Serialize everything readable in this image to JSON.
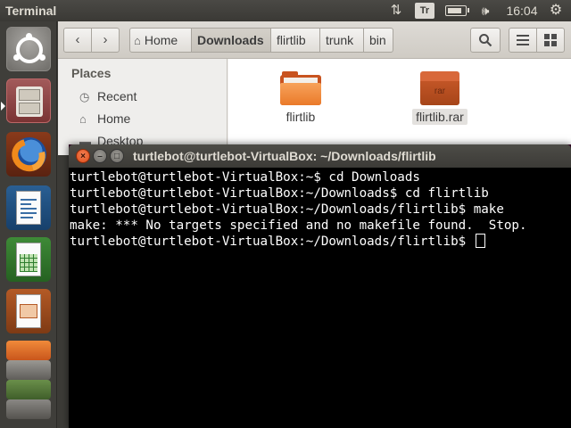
{
  "top_panel": {
    "title": "Terminal",
    "keyboard_layout": "Tr",
    "clock": "16:04",
    "icons": [
      "network-transfer-icon",
      "keyboard-icon",
      "battery-icon",
      "volume-icon",
      "settings-gear-icon"
    ]
  },
  "launcher": {
    "items": [
      "dash-home",
      "files",
      "firefox",
      "libreoffice-writer",
      "libreoffice-calc",
      "libreoffice-impress",
      "software-center",
      "system-settings",
      "workspaces"
    ]
  },
  "files": {
    "nav": {
      "back": "‹",
      "forward": "›"
    },
    "breadcrumbs": [
      "Home",
      "Downloads",
      "flirtlib",
      "trunk",
      "bin"
    ],
    "active_crumb": "Downloads",
    "sidebar": {
      "heading": "Places",
      "items": [
        {
          "label": "Recent",
          "icon": "clock-icon"
        },
        {
          "label": "Home",
          "icon": "home-icon"
        },
        {
          "label": "Desktop",
          "icon": "desktop-icon"
        }
      ]
    },
    "items": [
      {
        "name": "flirtlib",
        "type": "folder"
      },
      {
        "name": "flirtlib.rar",
        "type": "archive",
        "badge": "rar",
        "selected": true
      }
    ]
  },
  "terminal": {
    "title": "turtlebot@turtlebot-VirtualBox: ~/Downloads/flirtlib",
    "lines": [
      "turtlebot@turtlebot-VirtualBox:~$ cd Downloads",
      "turtlebot@turtlebot-VirtualBox:~/Downloads$ cd flirtlib",
      "turtlebot@turtlebot-VirtualBox:~/Downloads/flirtlib$ make",
      "make: *** No targets specified and no makefile found.  Stop."
    ],
    "prompt": "turtlebot@turtlebot-VirtualBox:~/Downloads/flirtlib$ "
  },
  "colors": {
    "panel": "#3c3b37",
    "terminal_bg": "#000000",
    "terminal_fg": "#ffffff",
    "close_button": "#df4a16",
    "folder": "#ea7a2a"
  }
}
